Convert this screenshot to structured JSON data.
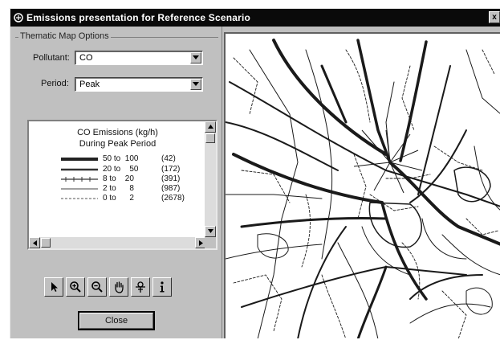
{
  "window": {
    "title": "Emissions presentation for Reference Scenario",
    "close_glyph": "x"
  },
  "options": {
    "group_label": "Thematic Map Options",
    "pollutant_label": "Pollutant:",
    "pollutant_value": "CO",
    "period_label": "Period:",
    "period_value": "Peak"
  },
  "legend": {
    "title": "CO Emissions (kg/h)",
    "subtitle": "During Peak Period",
    "rows": [
      {
        "range": "50 to  100",
        "count": "(42)",
        "style": "thick"
      },
      {
        "range": "20 to    50",
        "count": "(172)",
        "style": "medium"
      },
      {
        "range": "8 to    20",
        "count": "(391)",
        "style": "ticked"
      },
      {
        "range": "2 to      8",
        "count": "(987)",
        "style": "thin"
      },
      {
        "range": "0 to      2",
        "count": "(2678)",
        "style": "dashed"
      }
    ]
  },
  "toolbar": {
    "tools": [
      "pointer-icon",
      "zoom-in-icon",
      "zoom-out-icon",
      "pan-hand-icon",
      "identify-icon",
      "info-icon"
    ]
  },
  "close_button": {
    "label": "Close"
  },
  "colors": {
    "window_bg": "#c0c0c0",
    "titlebar_bg": "#0a0a0a",
    "map_bg": "#ffffff",
    "road": "#1a1a1a"
  }
}
